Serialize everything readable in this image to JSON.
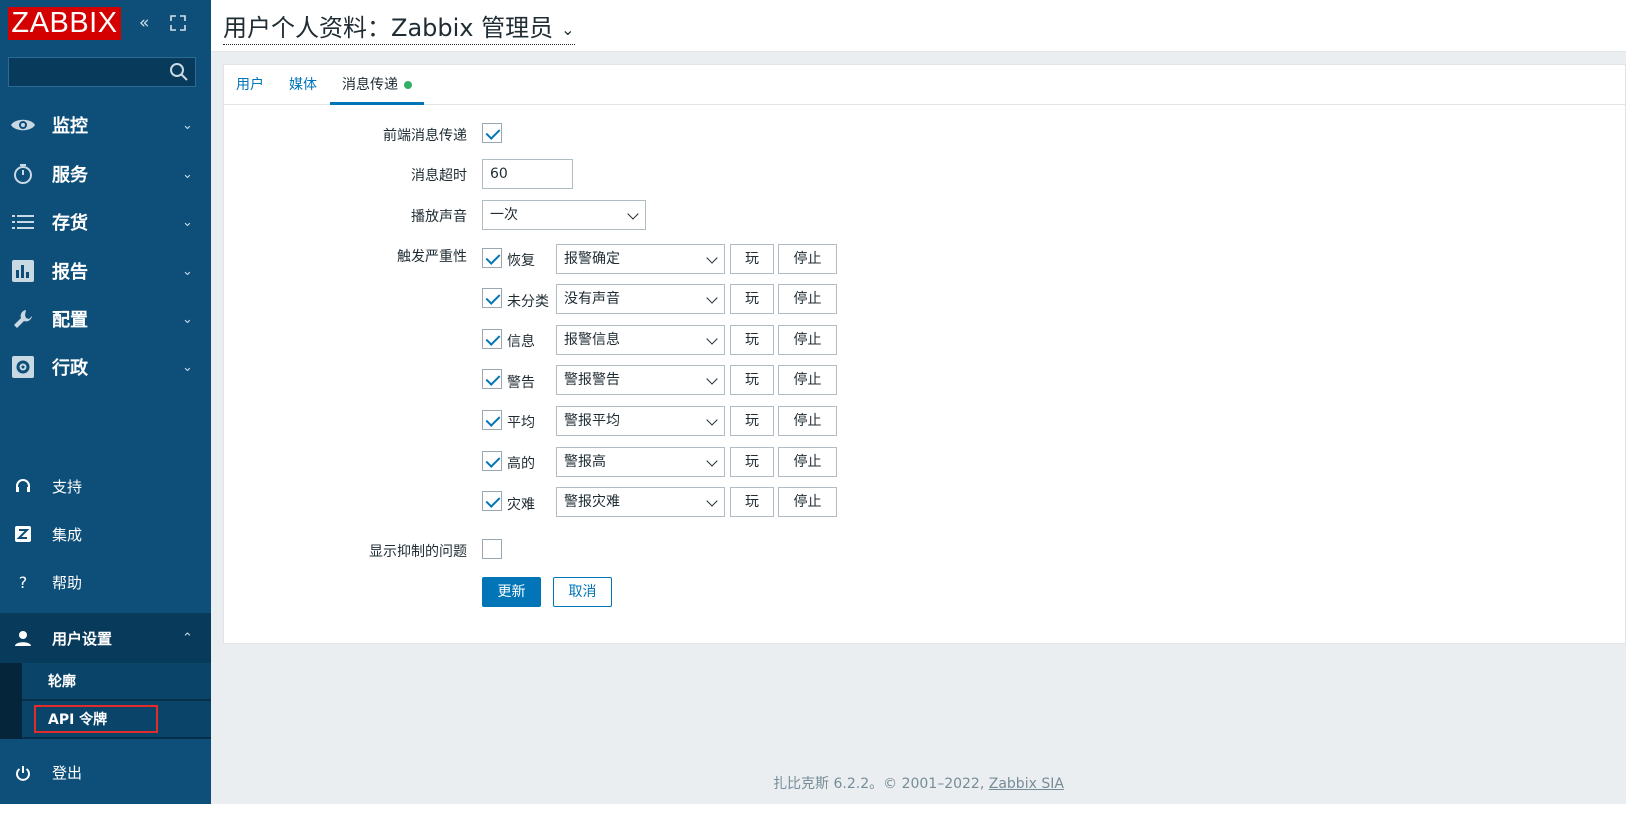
{
  "app": {
    "logo": "ZABBIX"
  },
  "sidebar": {
    "search_placeholder": "",
    "nav": [
      {
        "label": "监控",
        "icon": "eye-icon"
      },
      {
        "label": "服务",
        "icon": "stopwatch-icon"
      },
      {
        "label": "存货",
        "icon": "list-icon"
      },
      {
        "label": "报告",
        "icon": "bar-chart-icon"
      },
      {
        "label": "配置",
        "icon": "wrench-icon"
      },
      {
        "label": "行政",
        "icon": "gear-icon"
      }
    ],
    "lower": [
      {
        "label": "支持",
        "icon": "headset-icon"
      },
      {
        "label": "集成",
        "icon": "integration-icon"
      },
      {
        "label": "帮助",
        "icon": "help-icon"
      }
    ],
    "user_settings": {
      "label": "用户设置",
      "items": [
        {
          "label": "轮廓"
        },
        {
          "label": "API 令牌"
        }
      ]
    },
    "logout": "登出"
  },
  "header": {
    "title": "用户个人资料：Zabbix 管理员"
  },
  "tabs": [
    {
      "label": "用户"
    },
    {
      "label": "媒体"
    },
    {
      "label": "消息传递"
    }
  ],
  "form": {
    "frontend_messaging": {
      "label": "前端消息传递",
      "checked": true
    },
    "message_timeout": {
      "label": "消息超时",
      "value": "60"
    },
    "play_sound": {
      "label": "播放声音",
      "value": "一次"
    },
    "trigger_severity": {
      "label": "触发严重性",
      "rows": [
        {
          "name": "恢复",
          "sound": "报警确定",
          "checked": true
        },
        {
          "name": "未分类",
          "sound": "没有声音",
          "checked": true
        },
        {
          "name": "信息",
          "sound": "报警信息",
          "checked": true
        },
        {
          "name": "警告",
          "sound": "警报警告",
          "checked": true
        },
        {
          "name": "平均",
          "sound": "警报平均",
          "checked": true
        },
        {
          "name": "高的",
          "sound": "警报高",
          "checked": true
        },
        {
          "name": "灾难",
          "sound": "警报灾难",
          "checked": true
        }
      ],
      "play_label": "玩",
      "stop_label": "停止"
    },
    "show_suppressed": {
      "label": "显示抑制的问题",
      "checked": false
    },
    "update_label": "更新",
    "cancel_label": "取消"
  },
  "footer": {
    "text": "扎比克斯 6.2.2。© 2001–2022, ",
    "link": "Zabbix SIA"
  },
  "colors": {
    "sidebar": "#0e4f7a",
    "logo": "#d40000",
    "accent": "#0275b8",
    "active_dot": "#34af67"
  }
}
